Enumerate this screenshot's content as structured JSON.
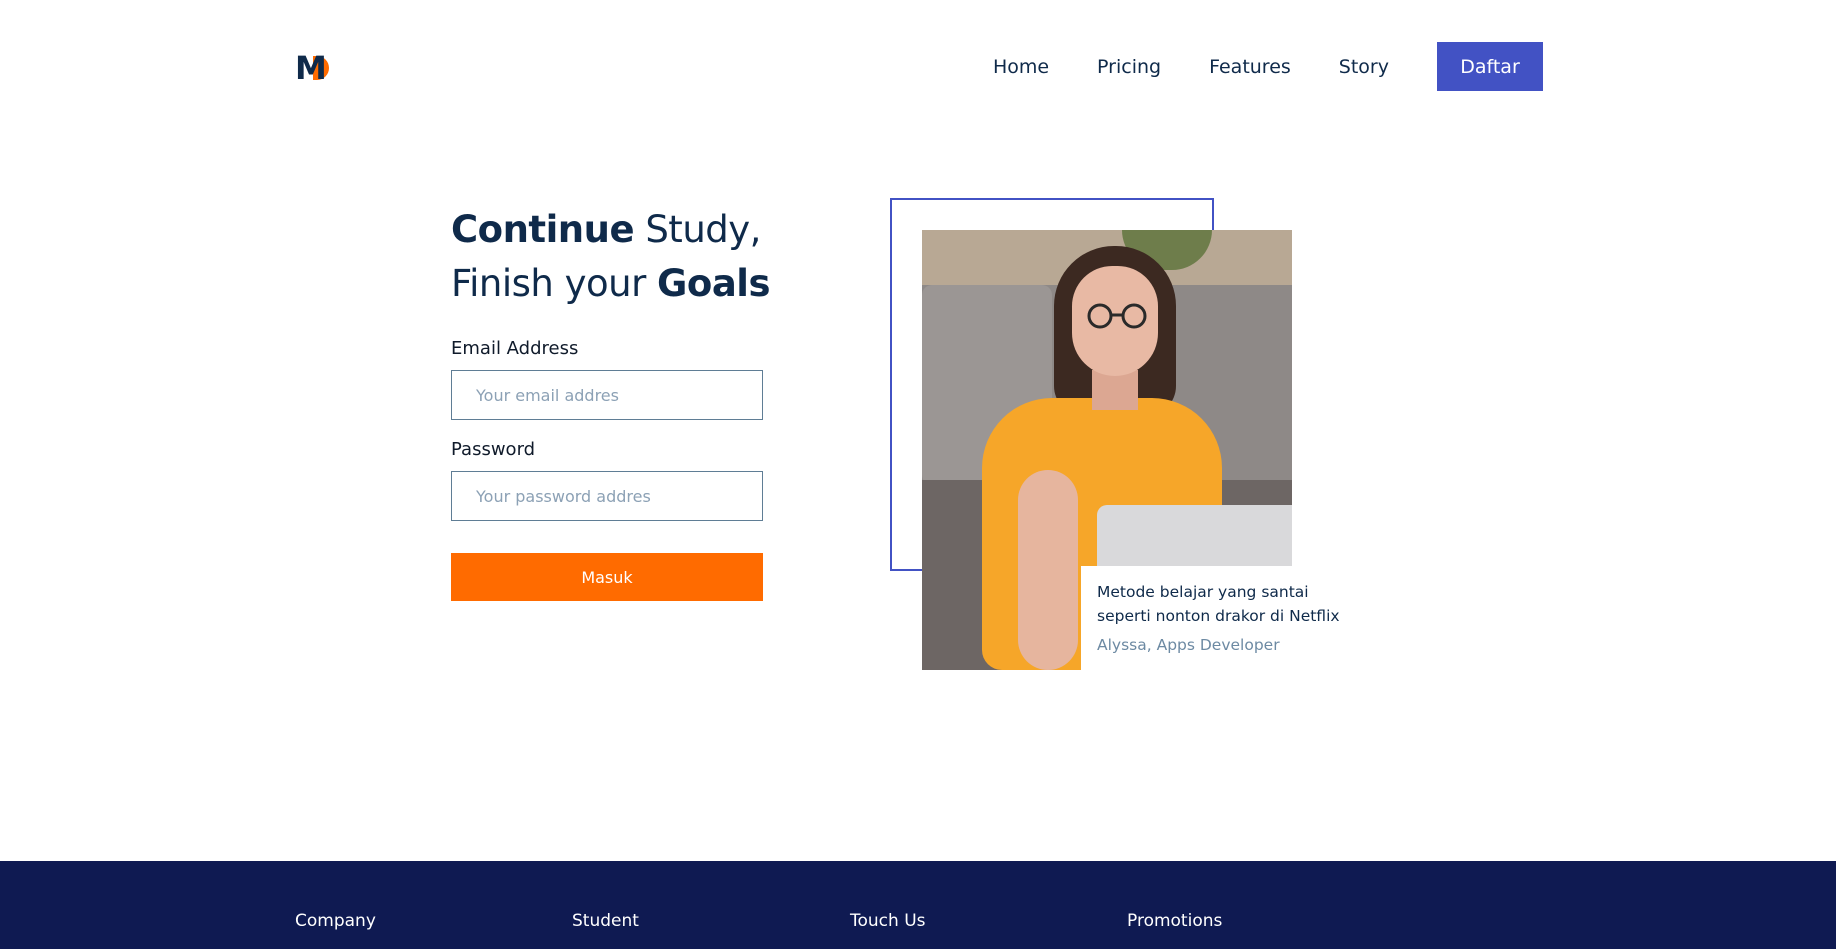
{
  "brand": {
    "logo_text": "M"
  },
  "nav": {
    "items": [
      "Home",
      "Pricing",
      "Features",
      "Story"
    ],
    "cta_label": "Daftar"
  },
  "login": {
    "headline_bold_1": "Continue",
    "headline_rest_1": " Study,",
    "headline_rest_2": "Finish your ",
    "headline_bold_2": "Goals",
    "email_label": "Email Address",
    "email_placeholder": "Your email addres",
    "password_label": "Password",
    "password_placeholder": "Your password addres",
    "submit_label": "Masuk"
  },
  "testimonial": {
    "text": "Metode belajar yang santai seperti nonton drakor di Netflix",
    "author": "Alyssa, Apps Developer"
  },
  "footer": {
    "columns": [
      "Company",
      "Student",
      "Touch Us",
      "Promotions"
    ]
  },
  "colors": {
    "primary": "#4252c4",
    "accent": "#ff6b00",
    "navy": "#0f2a4a",
    "footer_bg": "#0f1a52"
  }
}
